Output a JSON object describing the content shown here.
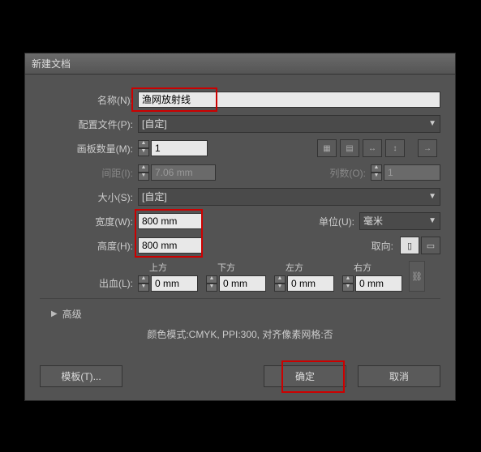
{
  "dialog": {
    "title": "新建文档"
  },
  "name": {
    "label": "名称(N):",
    "value": "渔网放射线"
  },
  "profile": {
    "label": "配置文件(P):",
    "value": "[自定]"
  },
  "artboards": {
    "label": "画板数量(M):",
    "value": "1"
  },
  "spacing": {
    "label": "间距(I):",
    "value": "7.06 mm"
  },
  "columns": {
    "label": "列数(O):",
    "value": "1"
  },
  "size": {
    "label": "大小(S):",
    "value": "[自定]"
  },
  "width": {
    "label": "宽度(W):",
    "value": "800 mm"
  },
  "height": {
    "label": "高度(H):",
    "value": "800 mm"
  },
  "units": {
    "label": "单位(U):",
    "value": "毫米"
  },
  "orientation": {
    "label": "取向:"
  },
  "bleed": {
    "label": "出血(L):",
    "top": {
      "hdr": "上方",
      "value": "0 mm"
    },
    "bottom": {
      "hdr": "下方",
      "value": "0 mm"
    },
    "left": {
      "hdr": "左方",
      "value": "0 mm"
    },
    "right": {
      "hdr": "右方",
      "value": "0 mm"
    }
  },
  "advanced": {
    "label": "高级"
  },
  "info": "颜色模式:CMYK, PPI:300, 对齐像素网格:否",
  "buttons": {
    "template": "模板(T)...",
    "ok": "确定",
    "cancel": "取消"
  }
}
